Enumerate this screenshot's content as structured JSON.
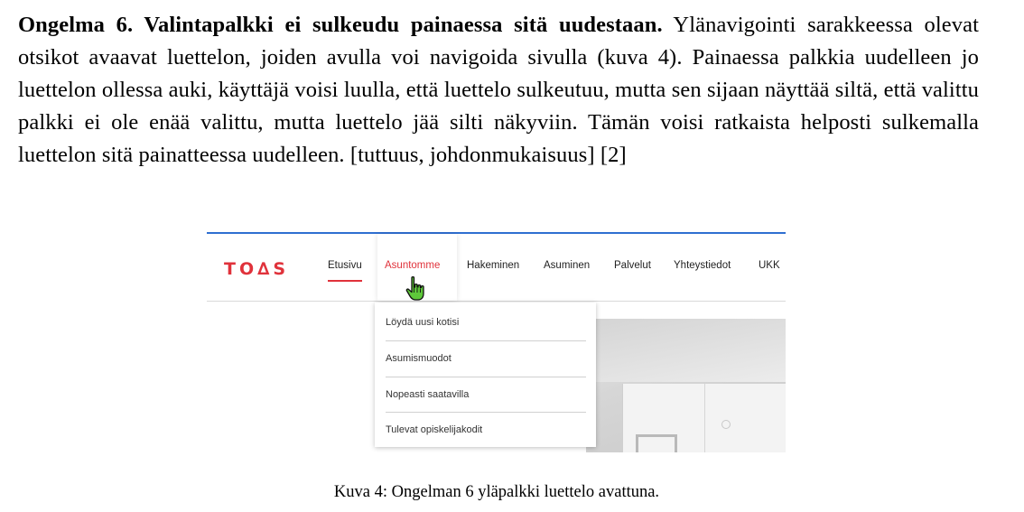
{
  "paragraph": {
    "bold_lead": "Ongelma 6. Valintapalkki ei sulkeudu painaessa sitä uudestaan.",
    "body": " Ylänavigointi sarakkeessa olevat otsikot avaavat luettelon, joiden avulla voi navigoida sivulla (kuva 4). Painaessa palkkia uudelleen jo luettelon ollessa auki, käyttäjä voisi luulla, että luettelo sulkeutuu, mutta sen sijaan näyttää siltä, että valittu palkki ei ole enää valittu, mutta luettelo jää silti näkyviin. Tämän voisi ratkaista helposti sulkemalla luettelon sitä painatteessa uudelleen. [tuttuus, johdonmukaisuus] [2]"
  },
  "figure": {
    "logo": "TO∆S",
    "nav": {
      "items": [
        "Etusivu",
        "Asuntomme",
        "Hakeminen",
        "Asuminen",
        "Palvelut",
        "Yhteystiedot",
        "UKK"
      ]
    },
    "dropdown": {
      "items": [
        "Löydä uusi kotisi",
        "Asumismuodot",
        "Nopeasti saatavilla",
        "Tulevat opiskelijakodit"
      ]
    },
    "colors": {
      "brand_red": "#e0323b",
      "top_line_blue": "#2f6fd1"
    },
    "cursor_icon": "hand-pointer-icon"
  },
  "caption": "Kuva 4: Ongelman 6 yläpalkki luettelo avattuna."
}
